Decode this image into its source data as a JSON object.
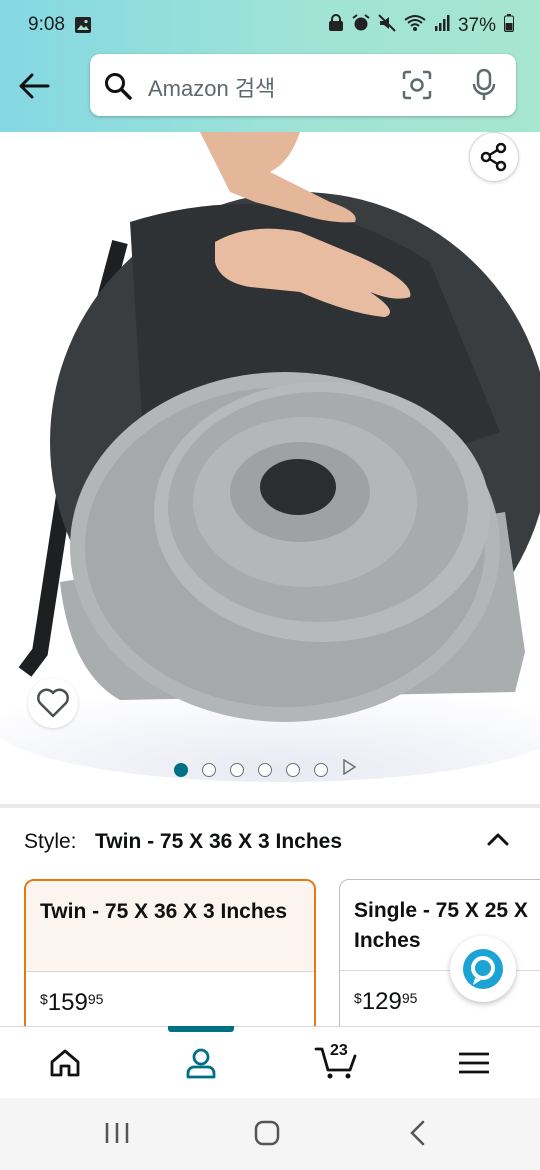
{
  "status_bar": {
    "time": "9:08",
    "battery": "37%"
  },
  "search": {
    "placeholder": "Amazon 검색"
  },
  "gallery": {
    "image_count": 6,
    "active_index": 0
  },
  "style": {
    "label": "Style:",
    "selected_value": "Twin - 75 X 36 X 3 Inches",
    "options": [
      {
        "title_line1": "Twin - 75 X 36 X 3 Inches",
        "title_line2": "",
        "price_symbol": "$",
        "price_whole": "159",
        "price_fraction": "95"
      },
      {
        "title_line1": "Single - 75 X 25 X",
        "title_line2": "Inches",
        "price_symbol": "$",
        "price_whole": "129",
        "price_fraction": "95"
      }
    ]
  },
  "bottom_nav": {
    "cart_count": "23",
    "active": "account"
  },
  "colors": {
    "accent": "#007185",
    "selected_border": "#e47911",
    "header_gradient_start": "#84d8e3",
    "header_gradient_end": "#a7e6cf"
  }
}
